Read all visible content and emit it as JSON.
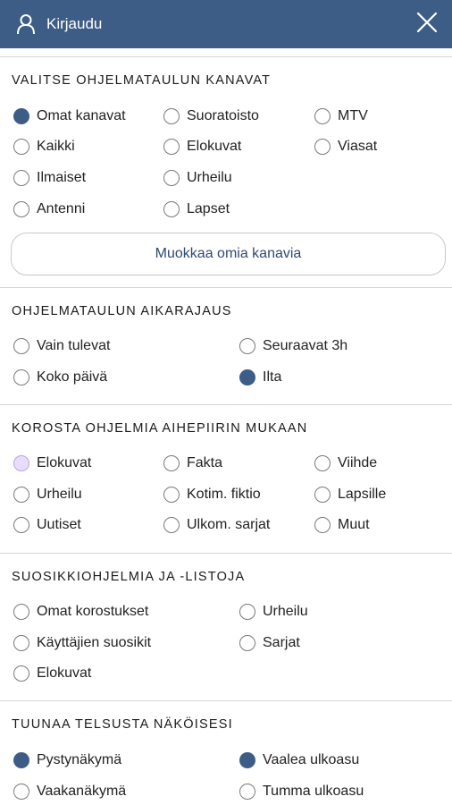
{
  "header": {
    "login_label": "Kirjaudu",
    "background_color": "#3d5d87",
    "user_icon": "user-icon",
    "close_icon": "close-icon"
  },
  "channels": {
    "title": "VALITSE OHJELMATAULUN KANAVAT",
    "options": [
      {
        "label": "Omat kanavat",
        "selected": true
      },
      {
        "label": "Suoratoisto",
        "selected": false
      },
      {
        "label": "MTV",
        "selected": false
      },
      {
        "label": "Kaikki",
        "selected": false
      },
      {
        "label": "Elokuvat",
        "selected": false
      },
      {
        "label": "Viasat",
        "selected": false
      },
      {
        "label": "Ilmaiset",
        "selected": false
      },
      {
        "label": "Urheilu",
        "selected": false
      },
      {
        "label": "Antenni",
        "selected": false
      },
      {
        "label": "Lapset",
        "selected": false
      }
    ],
    "edit_button": "Muokkaa omia kanavia"
  },
  "time_limit": {
    "title": "OHJELMATAULUN AIKARAJAUS",
    "options": [
      {
        "label": "Vain tulevat",
        "selected": false
      },
      {
        "label": "Seuraavat 3h",
        "selected": false
      },
      {
        "label": "Koko päivä",
        "selected": false
      },
      {
        "label": "Ilta",
        "selected": true
      }
    ]
  },
  "highlight": {
    "title": "KOROSTA OHJELMIA AIHEPIIRIN MUKAAN",
    "options": [
      {
        "label": "Elokuvat",
        "selected": true,
        "color": "#eadcff"
      },
      {
        "label": "Fakta",
        "selected": false
      },
      {
        "label": "Viihde",
        "selected": false
      },
      {
        "label": "Urheilu",
        "selected": false
      },
      {
        "label": "Kotim. fiktio",
        "selected": false
      },
      {
        "label": "Lapsille",
        "selected": false
      },
      {
        "label": "Uutiset",
        "selected": false
      },
      {
        "label": "Ulkom. sarjat",
        "selected": false
      },
      {
        "label": "Muut",
        "selected": false
      }
    ]
  },
  "favorites": {
    "title": "SUOSIKKIOHJELMIA JA -LISTOJA",
    "options": [
      {
        "label": "Omat korostukset",
        "selected": false
      },
      {
        "label": "Urheilu",
        "selected": false
      },
      {
        "label": "Käyttäjien suosikit",
        "selected": false
      },
      {
        "label": "Sarjat",
        "selected": false
      },
      {
        "label": "Elokuvat",
        "selected": false
      }
    ]
  },
  "appearance": {
    "title": "TUUNAA TELSUSTA NÄKÖISESI",
    "options": [
      {
        "label": "Pystynäkymä",
        "selected": true
      },
      {
        "label": "Vaalea ulkoasu",
        "selected": true
      },
      {
        "label": "Vaakanäkymä",
        "selected": false
      },
      {
        "label": "Tumma ulkoasu",
        "selected": false
      }
    ]
  }
}
